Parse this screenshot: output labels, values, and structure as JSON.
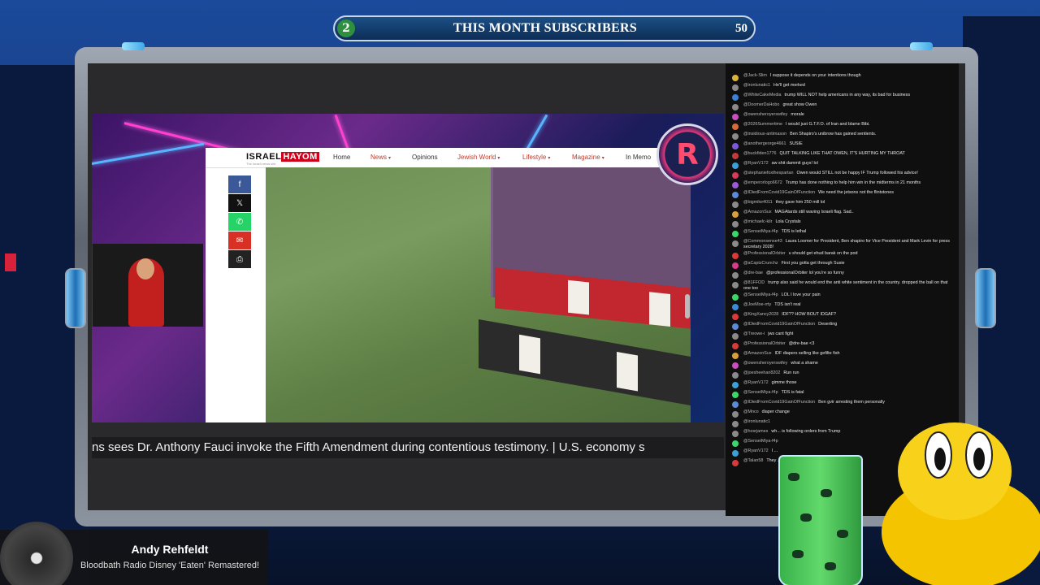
{
  "subscribers": {
    "current": "2",
    "label": "THIS MONTH SUBSCRIBERS",
    "goal": "50"
  },
  "webpage": {
    "logo_main": "ISRAEL",
    "logo_accent": "HAYOM",
    "logo_tagline": "The Israeli news site",
    "nav": [
      "Home",
      "News",
      "Opinions",
      "Jewish World",
      "Lifestyle",
      "Magazine",
      "In Memo"
    ]
  },
  "ticker": {
    "text": "ns sees Dr. Anthony Fauci invoke the Fifth Amendment during contentious testimony. | U.S. economy s"
  },
  "chat": [
    {
      "user": "@Jack-Slim",
      "text": "I suppose it depends on your intentions though",
      "color": "#d8b43a"
    },
    {
      "user": "@ironlunatic1",
      "text": "He'll get merked",
      "color": "#8a8a8a"
    },
    {
      "user": "@WhiteCakeMedia",
      "text": "trump WILL NOT help americans in any way, its bad for business",
      "color": "#3a7fd8"
    },
    {
      "user": "@DoomerDaHobo",
      "text": "great show Owen",
      "color": "#8a8a8a"
    },
    {
      "user": "@owensheroyerswifey",
      "text": "morale",
      "color": "#c94ec2"
    },
    {
      "user": "@2026Summertime",
      "text": "I would just G.T.F.O. of Iran and blame Bibi.",
      "color": "#d86a3a"
    },
    {
      "user": "@insidious-antimason",
      "text": "Ben Shapiro's unibrow has gained sentients.",
      "color": "#8a8a8a"
    },
    {
      "user": "@anothergeorge4661",
      "text": "SUSIE",
      "color": "#7a5ad8"
    },
    {
      "user": "@buckfiden1776",
      "text": "QUIT TALKING LIKE THAT OWEN, IT'S HURTING MY THROAT",
      "color": "#c23a3a"
    },
    {
      "user": "@RyanV172",
      "text": "aw shit dammit guys! lol",
      "color": "#3aa0d8"
    },
    {
      "user": "@stephaniefoxthespartan",
      "text": "Owen would STILL not be happy IF Trump followed his advice!",
      "color": "#d83a5a"
    },
    {
      "user": "@emperorlogo6672",
      "text": "Trump has done nothing to help him win in the midterms in 21 months",
      "color": "#9a5ad8"
    },
    {
      "user": "@IDiedFromCovid19GainOfFunction",
      "text": "We need the jetsons not the flintstones",
      "color": "#5a8ad8"
    },
    {
      "user": "@bigmike4011",
      "text": "they gave him 250 mill lol",
      "color": "#8a8a8a"
    },
    {
      "user": "@AmazonSux",
      "text": "MAGAtards still waving Israeli flag. Sad..",
      "color": "#d8a03a"
    },
    {
      "user": "@michaelc-kilr",
      "text": "Lola Crystals",
      "color": "#8a8a8a"
    },
    {
      "user": "@SenseiMiya-f4p",
      "text": "TDS is lethal",
      "color": "#3ad86a"
    },
    {
      "user": "@Commonsense43",
      "text": "Laura Loomer for President, Ben shapiro for Vice President and Mark Levin for press secretary 2028!",
      "color": "#8a8a8a"
    },
    {
      "user": "@ProfessionalOrbiter",
      "text": "u should get ehud barak on the pod",
      "color": "#d83a3a"
    },
    {
      "user": "@aCaptzCrunchz",
      "text": "First you gotta get through Susie",
      "color": "#d83a8a"
    },
    {
      "user": "@dre-bae",
      "text": "@professionalOrbiter lol you're so funny",
      "color": "#8a8a8a"
    },
    {
      "user": "@81FFOD",
      "text": "trump also said he would end the anti white sentiment in the country. dropped the ball on that one too",
      "color": "#8a8a8a"
    },
    {
      "user": "@SenseiMiya-f4p",
      "text": "LOL I love your pain",
      "color": "#3ad86a"
    },
    {
      "user": "@JoeMoe-rrty",
      "text": "TDS isn't real",
      "color": "#3a8ad8"
    },
    {
      "user": "@KingXancy2028",
      "text": "IDF?? HOW BOUT IDGAF?",
      "color": "#d83a3a"
    },
    {
      "user": "@IDiedFromCovid19GainOfFunction",
      "text": "Deserting",
      "color": "#5a8ad8"
    },
    {
      "user": "@Treowe-i",
      "text": "jws cant fight",
      "color": "#8a8a8a"
    },
    {
      "user": "@ProfessionalOrbiter",
      "text": "@dre-bae <3",
      "color": "#d83a3a"
    },
    {
      "user": "@AmazonSux",
      "text": "IDF diapers selling like gefilte fish",
      "color": "#d8a03a"
    },
    {
      "user": "@owensheroyerswifey",
      "text": "what a shame",
      "color": "#c94ec2"
    },
    {
      "user": "@joesheehan8202",
      "text": "Run run",
      "color": "#8a8a8a"
    },
    {
      "user": "@RyanV172",
      "text": "gimme those",
      "color": "#3aa0d8"
    },
    {
      "user": "@SenseiMiya-f4p",
      "text": "TDS is fatal",
      "color": "#3ad86a"
    },
    {
      "user": "@IDiedFromCovid19GainOfFunction",
      "text": "Ben gvir arresting them personally",
      "color": "#5a8ad8"
    },
    {
      "user": "@Mnco",
      "text": "diaper change",
      "color": "#8a8a8a"
    },
    {
      "user": "@ironlunatic1",
      "text": "",
      "color": "#8a8a8a"
    },
    {
      "user": "@hosrjames",
      "text": "wh... is following orders from Trump",
      "color": "#8a8a8a"
    },
    {
      "user": "@SenseiMiya-f4p",
      "text": "",
      "color": "#3ad86a"
    },
    {
      "user": "@RyanV172",
      "text": "I ...",
      "color": "#3aa0d8"
    },
    {
      "user": "@Talan58",
      "text": "They ...",
      "color": "#d83a3a"
    }
  ],
  "now_playing": {
    "artist": "Andy Rehfeldt",
    "song": "Bloodbath Radio Disney 'Eaten' Remastered!"
  }
}
